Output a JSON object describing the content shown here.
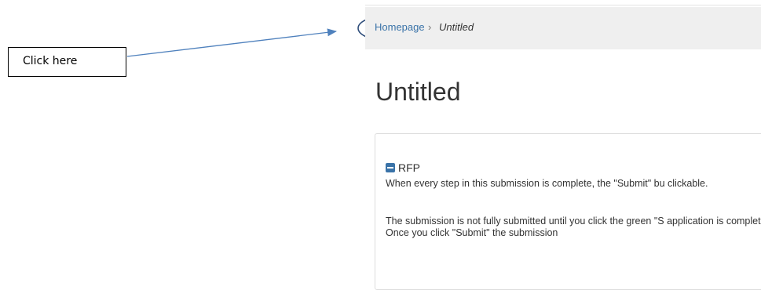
{
  "annotation": {
    "label": "Click here"
  },
  "breadcrumb": {
    "home": "Homepage",
    "separator": "›",
    "current": "Untitled"
  },
  "page": {
    "title": "Untitled"
  },
  "section": {
    "title": "RFP",
    "paragraph_1": "When every step in this submission is complete, the \"Submit\" bu clickable.",
    "paragraph_2": "The submission is not fully submitted until you click the green \"S application is complete.  Once you click \"Submit\" the submission"
  },
  "colors": {
    "link": "#3a73a8",
    "annotation_line": "#4f81bd",
    "annotation_circle": "#2e4d7a",
    "breadcrumb_bg": "#efefef"
  }
}
